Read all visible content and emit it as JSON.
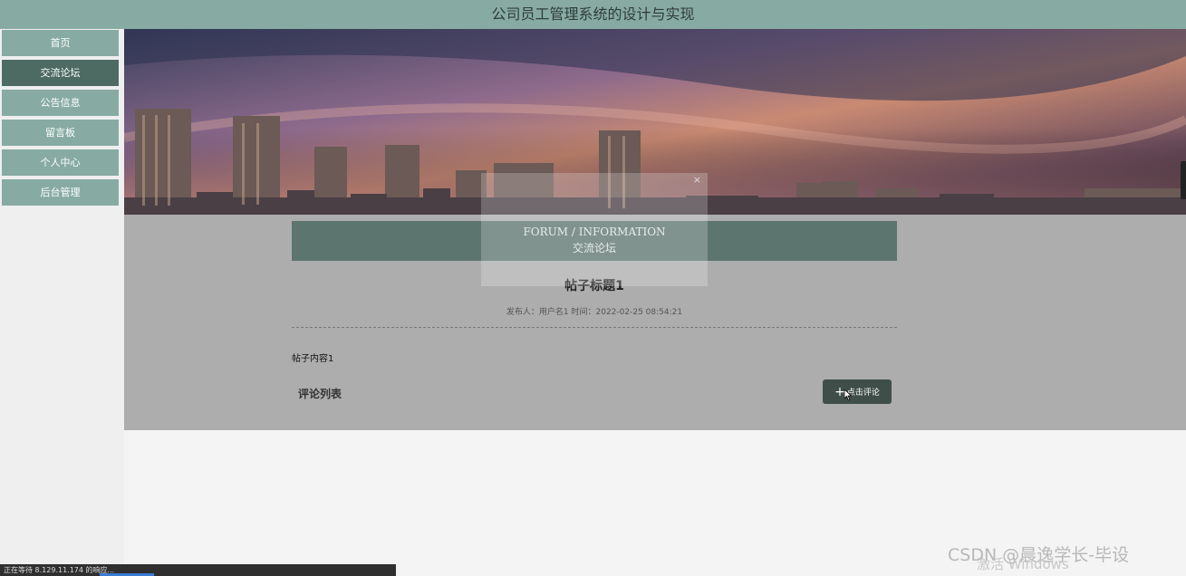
{
  "app_title": "公司员工管理系统的设计与实现",
  "nav": [
    {
      "label": "首页",
      "active": false
    },
    {
      "label": "交流论坛",
      "active": true
    },
    {
      "label": "公告信息",
      "active": false
    },
    {
      "label": "留言板",
      "active": false
    },
    {
      "label": "个人中心",
      "active": false
    },
    {
      "label": "后台管理",
      "active": false
    }
  ],
  "overlay": {
    "close": "×",
    "title_en": "FORUM / INFORMATION",
    "title_cn": "交流论坛"
  },
  "post": {
    "title": "帖子标题1",
    "meta": "发布人：用户名1 时间：2022-02-25 08:54:21",
    "content": "帖子内容1"
  },
  "comments": {
    "label": "评论列表",
    "button_label": "点击评论",
    "button_icon": "plus-icon"
  },
  "status_bar": "正在等待 8.129.11.174 的响应...",
  "watermark": "CSDN @晨逸学长-毕设",
  "watermark_overlay": "激活 Windows",
  "colors": {
    "topbar": "#87aba2",
    "nav_active": "#4e6b63",
    "section_header": "#5d756f",
    "button": "#3f4e49"
  }
}
